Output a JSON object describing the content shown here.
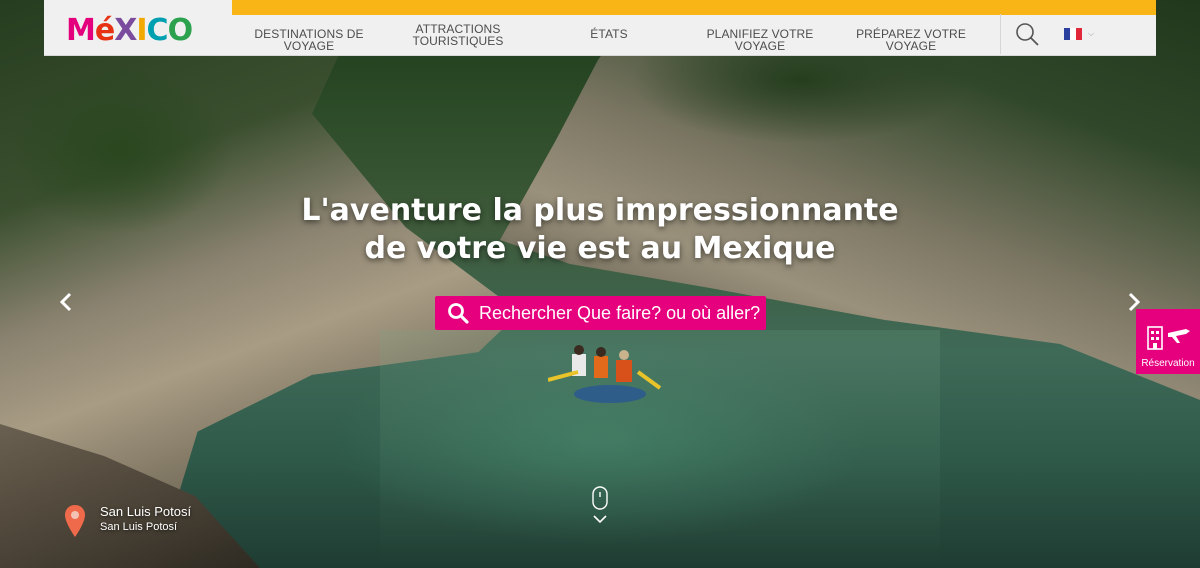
{
  "brand": {
    "logo_letters": [
      "M",
      "é",
      "X",
      "I",
      "C",
      "O"
    ],
    "colors": {
      "pink": "#e6007e",
      "yellow": "#f9b516"
    }
  },
  "nav": {
    "items": [
      {
        "label": "DESTINATIONS DE VOYAGE"
      },
      {
        "label_line1": "ATTRACTIONS",
        "label_line2": "TOURISTIQUES"
      },
      {
        "label": "ÉTATS"
      },
      {
        "label": "PLANIFIEZ VOTRE VOYAGE"
      },
      {
        "label": "PRÉPAREZ VOTRE VOYAGE"
      }
    ],
    "search_icon": "search-icon",
    "language_icon": "france-flag-icon"
  },
  "hero": {
    "headline_line1": "L'aventure la plus impressionnante",
    "headline_line2": "de votre vie est au Mexique",
    "search_label": "Rechercher Que faire? ou où aller?"
  },
  "reservation": {
    "label": "Réservation"
  },
  "location": {
    "title": "San Luis Potosí",
    "subtitle": "San Luis Potosí"
  }
}
